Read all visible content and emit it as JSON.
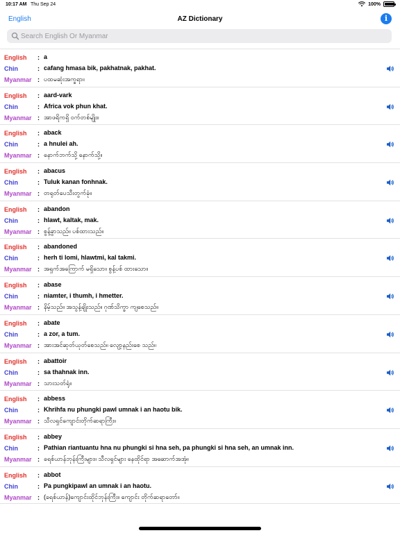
{
  "status_bar": {
    "time": "10:17 AM",
    "date": "Thu Sep 24",
    "battery_text": "100%",
    "battery_level": 1.0
  },
  "nav": {
    "left_label": "English",
    "title": "AZ Dictionary",
    "info_icon": "info-icon"
  },
  "search": {
    "placeholder": "Search English Or Myanmar",
    "value": ""
  },
  "labels": {
    "english": "English",
    "chin": "Chin",
    "myanmar": "Myanmar",
    "colon": ":"
  },
  "entries": [
    {
      "english": "a",
      "chin": "cafang hmasa bik, pakhatnak, pakhat.",
      "myanmar": "ပထမဆုံးအက္ခရာ။"
    },
    {
      "english": "aard-vark",
      "chin": "Africa vok phun khat.",
      "myanmar": "အာဖရိကရှိ ဝက်တစ်မျိုး။"
    },
    {
      "english": "aback",
      "chin": "a hnulei ah.",
      "myanmar": "နောက်ဘက်သို့ နောက်သို့။"
    },
    {
      "english": "abacus",
      "chin": "Tuluk kanan fonhnak.",
      "myanmar": "တရုတ်ပေသီးတွက်ခုံ။"
    },
    {
      "english": "abandon",
      "chin": "hlawt, kaltak, mak.",
      "myanmar": "စွန့်ခွာသည်။ ပစ်ထားသည်။"
    },
    {
      "english": "abandoned",
      "chin": "herh ti lomi, hlawtmi, kal takmi.",
      "myanmar": "အရှက်အကြောက် မရှိသော။ စွန့်ပစ် ထားသော။"
    },
    {
      "english": "abase",
      "chin": "niamter, i thumh, i hmetter.",
      "myanmar": "နိမ့်သည်။ အသွန့်ချိုးသည်။ ဂုဏ်သိက္ခာ ကျစေသည်။"
    },
    {
      "english": "abate",
      "chin": "a zor, a tum.",
      "myanmar": "အားအင်ဆုတ်ယုတ်စေသည်။ လျော့နည်းစေ သည်။"
    },
    {
      "english": "abattoir",
      "chin": "sa thahnak inn.",
      "myanmar": "သားသတ်ရုံ။"
    },
    {
      "english": "abbess",
      "chin": "Khrihfa nu phungki pawl umnak i an haotu bik.",
      "myanmar": "သီလရှင်ကျောင်းတိုက်ဆရာကြီး။"
    },
    {
      "english": "abbey",
      "chin": "Pathian riantuantu hna nu phungki si hna seh, pa phungki si hna seh, an umnak inn.",
      "myanmar": "ခရစ်ယာန်ဘုန်းကြီးများ။ သီလရှင်များ နေထိုင်ရာ အဆောက်အအုံ။"
    },
    {
      "english": "abbot",
      "chin": "Pa pungkipawl an umnak i an haotu.",
      "myanmar": "(ခရစ်ယာန်)ကျောင်းထိုင်ဘုန်းကြီး။ ကျောင်း တိုက်ဆရာတော်။"
    }
  ],
  "colors": {
    "accent": "#1a7cf0",
    "english_label": "#e0312b",
    "chin_label": "#4040d0",
    "myanmar_label": "#b048c8"
  }
}
